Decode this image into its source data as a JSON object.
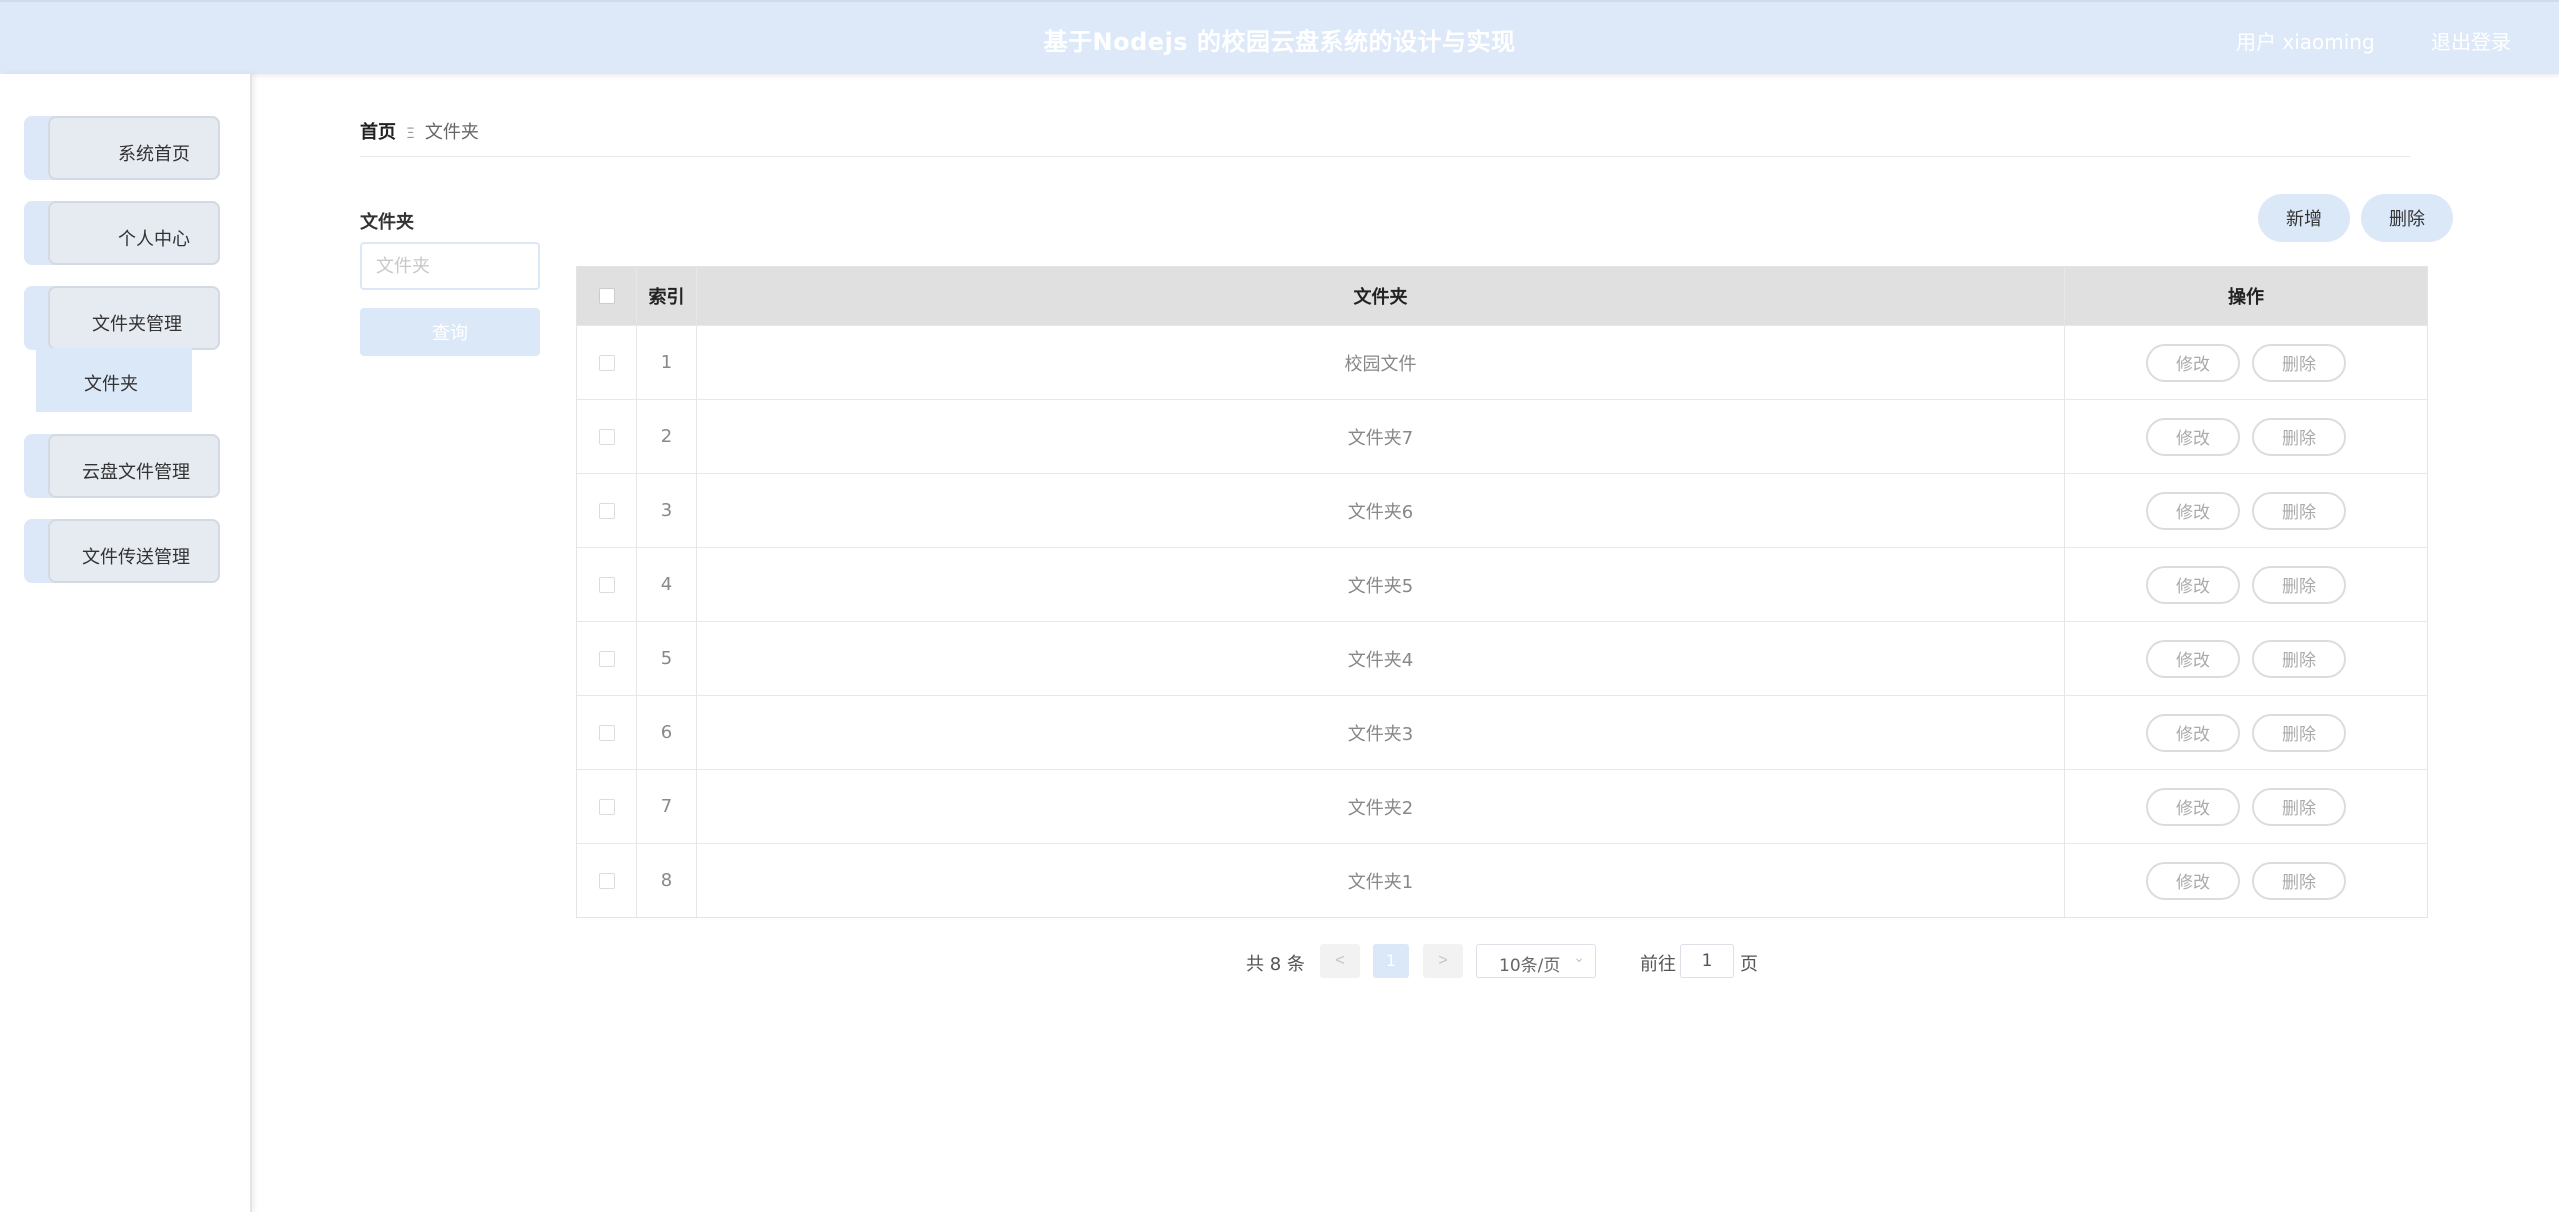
{
  "header": {
    "title": "基于Nodejs 的校园云盘系统的设计与实现",
    "user": "用户 xiaoming",
    "logout": "退出登录"
  },
  "sidebar": {
    "items": [
      {
        "label": "系统首页"
      },
      {
        "label": "个人中心"
      },
      {
        "label": "文件夹管理"
      },
      {
        "label": "云盘文件管理"
      },
      {
        "label": "文件传送管理"
      }
    ],
    "submenu_active": "文件夹"
  },
  "breadcrumb": {
    "home": "首页",
    "separator": "Ξ",
    "current": "文件夹"
  },
  "search": {
    "label": "文件夹",
    "placeholder": "文件夹",
    "button": "查询"
  },
  "actions": {
    "add": "新增",
    "delete": "删除"
  },
  "table": {
    "headers": {
      "index": "索引",
      "name": "文件夹",
      "operation": "操作"
    },
    "edit_label": "修改",
    "delete_label": "删除",
    "rows": [
      {
        "index": "1",
        "name": "校园文件"
      },
      {
        "index": "2",
        "name": "文件夹7"
      },
      {
        "index": "3",
        "name": "文件夹6"
      },
      {
        "index": "4",
        "name": "文件夹5"
      },
      {
        "index": "5",
        "name": "文件夹4"
      },
      {
        "index": "6",
        "name": "文件夹3"
      },
      {
        "index": "7",
        "name": "文件夹2"
      },
      {
        "index": "8",
        "name": "文件夹1"
      }
    ]
  },
  "pagination": {
    "total": "共 8 条",
    "prev": "<",
    "current": "1",
    "next": ">",
    "page_size": "10条/页",
    "goto_label": "前往",
    "goto_value": "1",
    "page_unit": "页"
  }
}
